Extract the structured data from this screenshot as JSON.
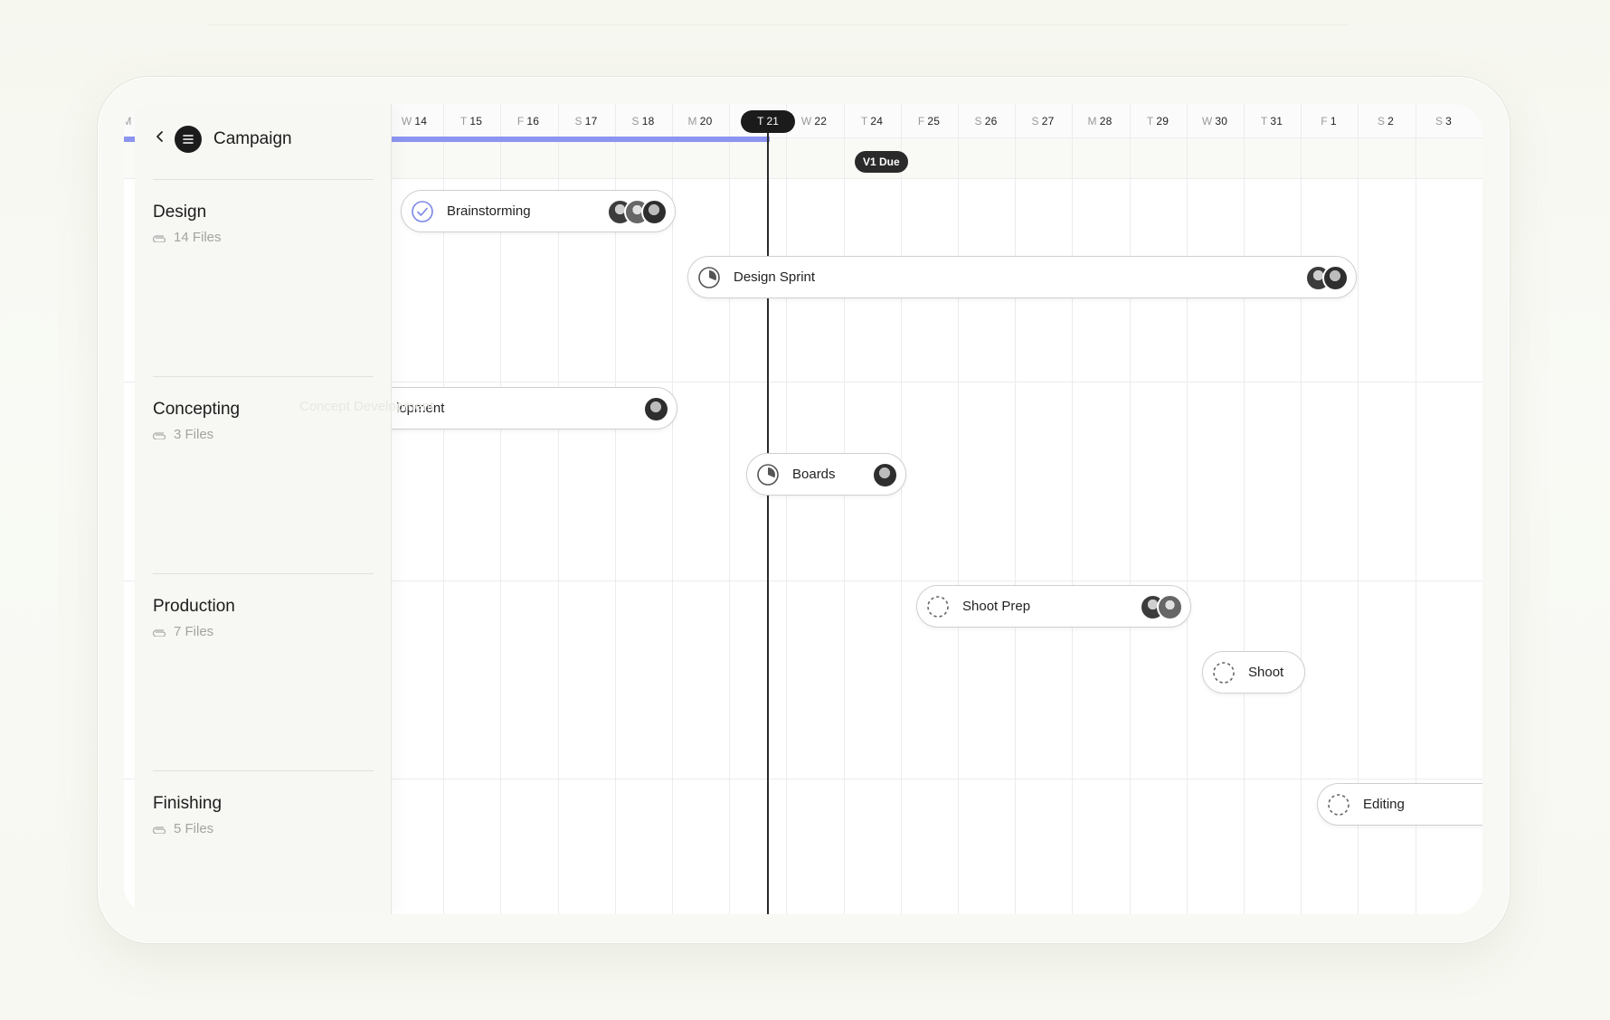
{
  "app": {
    "title": "Campaign"
  },
  "timeline": {
    "days": [
      {
        "dow": "M",
        "num": ""
      },
      {
        "dow": "",
        "num": ""
      },
      {
        "dow": "",
        "num": ""
      },
      {
        "dow": "",
        "num": ""
      },
      {
        "dow": "",
        "num": ""
      },
      {
        "dow": "W",
        "num": "14"
      },
      {
        "dow": "T",
        "num": "15"
      },
      {
        "dow": "F",
        "num": "16"
      },
      {
        "dow": "S",
        "num": "17"
      },
      {
        "dow": "S",
        "num": "18"
      },
      {
        "dow": "M",
        "num": "20"
      },
      {
        "dow": "T",
        "num": "21"
      },
      {
        "dow": "W",
        "num": "22"
      },
      {
        "dow": "T",
        "num": "24"
      },
      {
        "dow": "F",
        "num": "25"
      },
      {
        "dow": "S",
        "num": "26"
      },
      {
        "dow": "S",
        "num": "27"
      },
      {
        "dow": "M",
        "num": "28"
      },
      {
        "dow": "T",
        "num": "29"
      },
      {
        "dow": "W",
        "num": "30"
      },
      {
        "dow": "T",
        "num": "31"
      },
      {
        "dow": "F",
        "num": "1"
      },
      {
        "dow": "S",
        "num": "2"
      },
      {
        "dow": "S",
        "num": "3"
      }
    ],
    "today_label": "T 21",
    "due_badge": "V1 Due"
  },
  "groups": [
    {
      "name": "Design",
      "files": "14 Files"
    },
    {
      "name": "Concepting",
      "files": "3 Files"
    },
    {
      "name": "Production",
      "files": "7 Files"
    },
    {
      "name": "Finishing",
      "files": "5 Files"
    }
  ],
  "tasks": {
    "brainstorming": {
      "label": "Brainstorming",
      "status": "done"
    },
    "design_sprint": {
      "label": "Design Sprint",
      "status": "in-progress"
    },
    "concept_development": {
      "label": "Concept Development",
      "visible_label": "lopment",
      "status": "in-progress"
    },
    "boards": {
      "label": "Boards",
      "status": "in-progress"
    },
    "shoot_prep": {
      "label": "Shoot Prep",
      "status": "not-started"
    },
    "shoot": {
      "label": "Shoot",
      "status": "not-started"
    },
    "editing": {
      "label": "Editing",
      "status": "not-started"
    }
  },
  "colors": {
    "accent": "#8b95f0",
    "today": "#1b1b1b",
    "done_check": "#7b86e6"
  },
  "icons": [
    "back-chevron-icon",
    "menu-logo-icon",
    "paperclip-icon",
    "check-circle-icon",
    "pie-progress-icon",
    "dashed-circle-icon"
  ]
}
